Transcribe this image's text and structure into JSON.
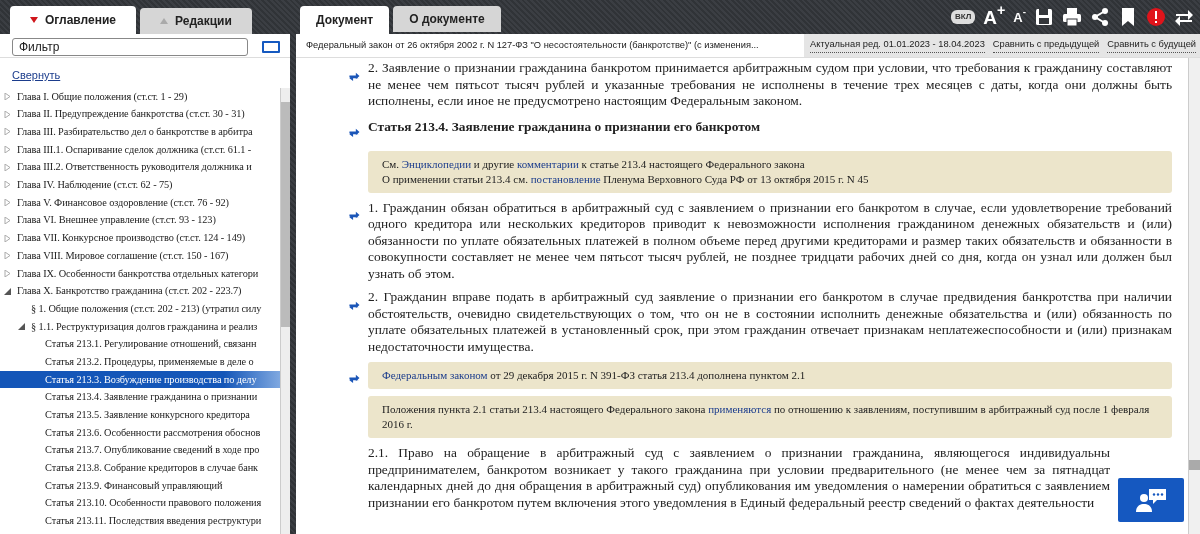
{
  "left_tabs": [
    {
      "label": "Оглавление",
      "selected": true
    },
    {
      "label": "Редакции",
      "selected": false
    }
  ],
  "filter": {
    "placeholder": "Фильтр"
  },
  "collapse_link": "Свернуть",
  "tree": [
    {
      "label": "Глава I. Общие положения (ст.ст. 1 - 29)",
      "expanded": false,
      "selected": false
    },
    {
      "label": "Глава II. Предупреждение банкротства (ст.ст. 30 - 31)",
      "expanded": false,
      "selected": false
    },
    {
      "label": "Глава III. Разбирательство дел о банкротстве в арбитра",
      "expanded": false,
      "selected": false
    },
    {
      "label": "Глава III.1. Оспаривание сделок должника (ст.ст. 61.1 -",
      "expanded": false,
      "selected": false
    },
    {
      "label": "Глава III.2. Ответственность руководителя должника и",
      "expanded": false,
      "selected": false
    },
    {
      "label": "Глава IV. Наблюдение (ст.ст. 62 - 75)",
      "expanded": false,
      "selected": false
    },
    {
      "label": "Глава V. Финансовое оздоровление (ст.ст. 76 - 92)",
      "expanded": false,
      "selected": false
    },
    {
      "label": "Глава VI. Внешнее управление (ст.ст. 93 - 123)",
      "expanded": false,
      "selected": false
    },
    {
      "label": "Глава VII. Конкурсное производство (ст.ст. 124 - 149)",
      "expanded": false,
      "selected": false
    },
    {
      "label": "Глава VIII. Мировое соглашение (ст.ст. 150 - 167)",
      "expanded": false,
      "selected": false
    },
    {
      "label": "Глава IX. Особенности банкротства отдельных категори",
      "expanded": false,
      "selected": false
    },
    {
      "label": "Глава X. Банкротство гражданина (ст.ст. 202 - 223.7)",
      "expanded": true,
      "selected": false,
      "children": [
        {
          "label": "§ 1. Общие положения (ст.ст. 202 - 213) (утратил силу",
          "selected": false
        },
        {
          "label": "§ 1.1. Реструктуризация долгов гражданина и реализ",
          "expanded": true,
          "selected": false,
          "children": [
            {
              "label": "Статья 213.1. Регулирование отношений, связанн",
              "selected": false
            },
            {
              "label": "Статья 213.2. Процедуры, применяемые в деле о",
              "selected": false
            },
            {
              "label": "Статья 213.3. Возбуждение производства по делу",
              "selected": true
            },
            {
              "label": "Статья 213.4. Заявление гражданина о признании",
              "selected": false
            },
            {
              "label": "Статья 213.5. Заявление конкурсного кредитора",
              "selected": false
            },
            {
              "label": "Статья 213.6. Особенности рассмотрения обоснов",
              "selected": false
            },
            {
              "label": "Статья 213.7. Опубликование сведений в ходе про",
              "selected": false
            },
            {
              "label": "Статья 213.8. Собрание кредиторов в случае банк",
              "selected": false
            },
            {
              "label": "Статья 213.9. Финансовый управляющий",
              "selected": false
            },
            {
              "label": "Статья 213.10. Особенности правового положения",
              "selected": false
            },
            {
              "label": "Статья 213.11. Последствия введения реструктури",
              "selected": false
            }
          ]
        }
      ]
    }
  ],
  "doc_tabs": [
    {
      "label": "Документ",
      "selected": true
    },
    {
      "label": "О документе",
      "selected": false
    }
  ],
  "toolbar": [
    {
      "kind": "badge",
      "label": "ВКЛ"
    },
    {
      "kind": "text",
      "label": "A$^{+}$"
    },
    {
      "kind": "text_small",
      "label": "A$^{-}$"
    },
    {
      "kind": "save"
    },
    {
      "kind": "print"
    },
    {
      "kind": "share"
    },
    {
      "kind": "bookmark"
    },
    {
      "kind": "alert"
    },
    {
      "kind": "swap"
    }
  ],
  "doc_title": "Федеральный закон от 26 октября 2002 г. N 127-ФЗ \"О несостоятельности (банкротстве)\" (с изменения...",
  "doc_links": [
    "Актуальная ред. 01.01.2023 - 18.04.2023",
    "Сравнить с предыдущей",
    "Сравнить с будущей"
  ],
  "content": [
    {
      "kind": "para",
      "marker": true,
      "text": "2. Заявление о признании гражданина банкротом принимается арбитражным судом при условии, что требования к гражданину составляют не менее чем пятьсот тысяч рублей и указанные требования не исполнены в течение трех месяцев с даты, когда они должны быть исполнены, если иное не предусмотрено настоящим Федеральным законом."
    },
    {
      "kind": "heading",
      "marker": true,
      "text": "Статья 213.4. Заявление гражданина о признании его банкротом"
    },
    {
      "kind": "note",
      "marker": false,
      "lines": [
        [
          {
            "text": "См. "
          },
          {
            "link": "Энциклопедии"
          },
          {
            "text": " и другие "
          },
          {
            "link": "комментарии"
          },
          {
            "text": " к статье 213.4 настоящего Федерального закона"
          }
        ],
        [
          {
            "text": "О применении статьи 213.4 см. "
          },
          {
            "link": "постановление"
          },
          {
            "text": " Пленума Верховного Суда РФ от 13 октября 2015 г. N 45"
          }
        ]
      ]
    },
    {
      "kind": "para",
      "marker": true,
      "text": "1. Гражданин обязан обратиться в арбитражный суд с заявлением о признании его банкротом в случае, если удовлетворение требований одного кредитора или нескольких кредиторов приводит к невозможности исполнения гражданином денежных обязательств и (или) обязанности по уплате обязательных платежей в полном объеме перед другими кредиторами и размер таких обязательств и обязанности в совокупности составляет не менее чем пятьсот тысяч рублей, не позднее тридцати рабочих дней со дня, когда он узнал или должен был узнать об этом."
    },
    {
      "kind": "para",
      "marker": true,
      "text": "2. Гражданин вправе подать в арбитражный суд заявление о признании его банкротом в случае предвидения банкротства при наличии обстоятельств, очевидно свидетельствующих о том, что он не в состоянии исполнить денежные обязательства и (или) обязанность по уплате обязательных платежей в установленный срок, при этом гражданин отвечает признакам неплатежеспособности и (или) признакам недостаточности имущества."
    },
    {
      "kind": "note",
      "marker": true,
      "lines": [
        [
          {
            "link": "Федеральным законом"
          },
          {
            "text": " от 29 декабря 2015 г. N 391-ФЗ статья 213.4 дополнена пунктом 2.1"
          }
        ]
      ]
    },
    {
      "kind": "note",
      "marker": false,
      "lines": [
        [
          {
            "text": "Положения пункта 2.1 статьи 213.4 настоящего Федерального закона "
          },
          {
            "link": "применяются"
          },
          {
            "text": " по отношению к заявлениям, поступившим в арбитражный суд после 1 февраля 2016 г."
          }
        ]
      ]
    },
    {
      "kind": "para",
      "marker": false,
      "text": "2.1. Право на обращение в арбитражный суд с заявлением о признании гражданина, являющегося индивидуальны предпринимателем, банкротом возникает у такого гражданина при условии предварительного (не менее чем за пятнадцат календарных дней до дня обращения в арбитражный суд) опубликования им уведомления о намерении обратиться с заявлением признании его банкротом путем включения этого уведомления в Единый федеральный реестр сведений о фактах деятельности"
    }
  ]
}
